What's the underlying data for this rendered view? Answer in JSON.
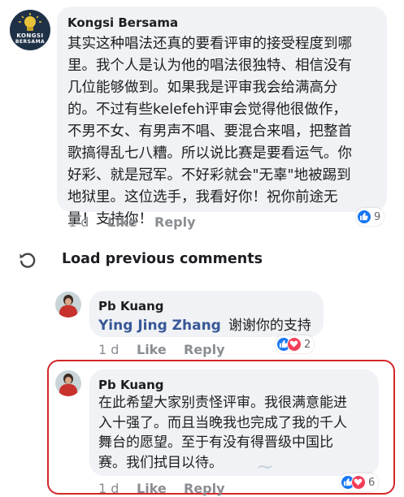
{
  "comments": [
    {
      "author": "Kongsi Bersama",
      "avatar_lines": [
        "KONGSI",
        "BERSAMA"
      ],
      "lines": [
        "其实这种唱法还真的要看评审的接受程度到哪",
        "里。我个人是认为他的唱法很独特、相信没有",
        "几位能够做到。如果我是评审我会给满高分",
        "的。不过有些kelefeh评审会觉得他很做作，",
        "不男不女、有男声不唱、要混合来唱，把整首",
        "歌搞得乱七八糟。所以说比赛是要看运气。你",
        "好彩、就是冠军。不好彩就会\"无辜\"地被踢到",
        "地狱里。这位选手，我看好你！祝你前途无",
        "量！支持你！"
      ],
      "time": "1 d",
      "like_label": "Like",
      "reply_label": "Reply",
      "reaction_count": "9"
    }
  ],
  "load_previous": "Load previous comments",
  "replies": [
    {
      "author": "Pb Kuang",
      "mention": "Ying Jing Zhang",
      "text": "谢谢你的支持",
      "time": "1 d",
      "like_label": "Like",
      "reply_label": "Reply",
      "reaction_count": "2"
    },
    {
      "author": "Pb Kuang",
      "lines": [
        "在此希望大家别责怪评审。我很满意能进",
        "入十强了。而且当晚我也完成了我的千人",
        "舞台的愿望。至于有没有得晋级中国比",
        "赛。我们拭目以待。"
      ],
      "time": "1 d",
      "like_label": "Like",
      "reply_label": "Reply",
      "reaction_count": "6"
    }
  ],
  "colors": {
    "link": "#385898",
    "like": "#1877f2",
    "love": "#f33e58",
    "highlight": "#d4262c"
  }
}
